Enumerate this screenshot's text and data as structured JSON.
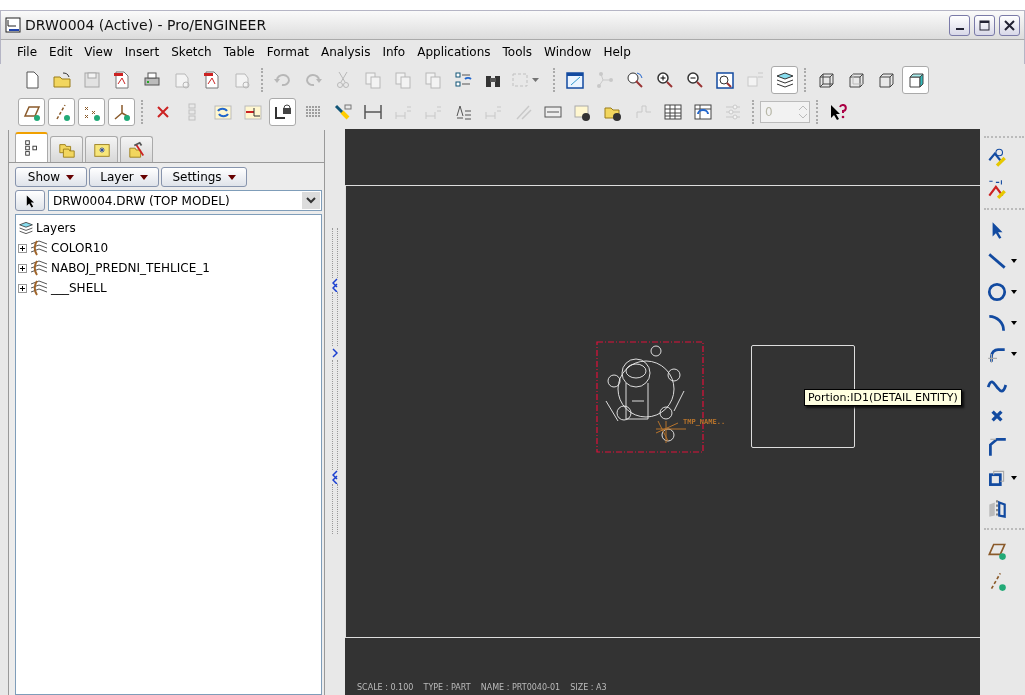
{
  "window": {
    "title": "DRW0004 (Active) - Pro/ENGINEER"
  },
  "menu": [
    "File",
    "Edit",
    "View",
    "Insert",
    "Sketch",
    "Table",
    "Format",
    "Analysis",
    "Info",
    "Applications",
    "Tools",
    "Window",
    "Help"
  ],
  "toolbar_rows": [
    [
      {
        "kind": "button",
        "disabled": false,
        "pressed": false
      },
      {
        "kind": "button",
        "disabled": false,
        "pressed": false
      },
      {
        "kind": "button",
        "disabled": true,
        "pressed": false
      },
      {
        "kind": "button",
        "disabled": false,
        "pressed": false
      },
      {
        "kind": "button",
        "disabled": false,
        "pressed": false
      },
      {
        "kind": "button",
        "disabled": true,
        "pressed": false
      },
      {
        "kind": "button",
        "disabled": false,
        "pressed": false
      },
      {
        "kind": "button",
        "disabled": true,
        "pressed": false
      },
      {
        "kind": "separator"
      },
      {
        "kind": "button",
        "disabled": true,
        "pressed": false
      },
      {
        "kind": "button",
        "disabled": true,
        "pressed": false
      },
      {
        "kind": "button",
        "disabled": true,
        "pressed": false
      },
      {
        "kind": "button",
        "disabled": true,
        "pressed": false
      },
      {
        "kind": "button",
        "disabled": true,
        "pressed": false
      },
      {
        "kind": "button",
        "disabled": true,
        "pressed": false
      },
      {
        "kind": "button",
        "disabled": false,
        "pressed": false
      },
      {
        "kind": "button",
        "disabled": false,
        "pressed": false
      },
      {
        "kind": "dropdown",
        "disabled": true,
        "pressed": false
      },
      {
        "kind": "separator"
      },
      {
        "kind": "button",
        "disabled": false,
        "pressed": false
      },
      {
        "kind": "button",
        "disabled": true,
        "pressed": false
      },
      {
        "kind": "button",
        "disabled": false,
        "pressed": false
      },
      {
        "kind": "button",
        "disabled": false,
        "pressed": false
      },
      {
        "kind": "button",
        "disabled": false,
        "pressed": false
      },
      {
        "kind": "button",
        "disabled": false,
        "pressed": false
      },
      {
        "kind": "button",
        "disabled": true,
        "pressed": false
      },
      {
        "kind": "button",
        "disabled": false,
        "pressed": true
      },
      {
        "kind": "separator"
      },
      {
        "kind": "button",
        "disabled": false,
        "pressed": false
      },
      {
        "kind": "button",
        "disabled": false,
        "pressed": false
      },
      {
        "kind": "button",
        "disabled": false,
        "pressed": false
      },
      {
        "kind": "button",
        "disabled": false,
        "pressed": true
      }
    ],
    [
      {
        "kind": "button",
        "disabled": false,
        "pressed": true
      },
      {
        "kind": "button",
        "disabled": false,
        "pressed": true
      },
      {
        "kind": "button",
        "disabled": false,
        "pressed": true
      },
      {
        "kind": "button",
        "disabled": false,
        "pressed": true
      },
      {
        "kind": "separator"
      },
      {
        "kind": "button",
        "disabled": false,
        "pressed": false
      },
      {
        "kind": "button",
        "disabled": true,
        "pressed": false
      },
      {
        "kind": "button",
        "disabled": false,
        "pressed": false
      },
      {
        "kind": "button",
        "disabled": false,
        "pressed": false
      },
      {
        "kind": "button",
        "disabled": false,
        "pressed": true
      },
      {
        "kind": "button",
        "disabled": false,
        "pressed": false
      },
      {
        "kind": "button",
        "disabled": false,
        "pressed": false
      },
      {
        "kind": "button",
        "disabled": false,
        "pressed": false
      },
      {
        "kind": "button",
        "disabled": true,
        "pressed": false
      },
      {
        "kind": "button",
        "disabled": true,
        "pressed": false
      },
      {
        "kind": "button",
        "disabled": false,
        "pressed": false
      },
      {
        "kind": "button",
        "disabled": true,
        "pressed": false
      },
      {
        "kind": "button",
        "disabled": true,
        "pressed": false
      },
      {
        "kind": "button",
        "disabled": false,
        "pressed": false
      },
      {
        "kind": "button",
        "disabled": false,
        "pressed": false
      },
      {
        "kind": "button",
        "disabled": false,
        "pressed": false
      },
      {
        "kind": "button",
        "disabled": true,
        "pressed": false
      },
      {
        "kind": "button",
        "disabled": false,
        "pressed": false
      },
      {
        "kind": "button",
        "disabled": false,
        "pressed": false
      },
      {
        "kind": "button",
        "disabled": true,
        "pressed": false
      },
      {
        "kind": "separator"
      },
      {
        "kind": "spinner",
        "value": "0",
        "disabled": true
      },
      {
        "kind": "separator"
      },
      {
        "kind": "button",
        "disabled": false,
        "pressed": false
      }
    ]
  ],
  "panel": {
    "tabs": [
      {
        "selected": true
      },
      {
        "selected": false
      },
      {
        "selected": false
      },
      {
        "selected": false
      }
    ],
    "buttons": [
      "Show",
      "Layer",
      "Settings"
    ],
    "model_selector": {
      "value": "DRW0004.DRW (TOP MODEL)"
    },
    "tree": {
      "label": "Layers",
      "children": [
        {
          "label": "COLOR10",
          "expanded": false
        },
        {
          "label": "NABOJ_PREDNI_TEHLICE_1",
          "expanded": false
        },
        {
          "label": "___SHELL",
          "expanded": false
        }
      ]
    }
  },
  "canvas": {
    "note_label": "TMP_NAME..",
    "tooltip": "Portion:ID1(DETAIL ENTITY)",
    "title_block": "SCALE : 0.100    TYPE : PART    NAME : PRT0040-01    SIZE : A3"
  },
  "side_tools": [
    {
      "kind": "separator"
    },
    {
      "kind": "button",
      "has_menu": false
    },
    {
      "kind": "button",
      "has_menu": false
    },
    {
      "kind": "separator"
    },
    {
      "kind": "button",
      "has_menu": false
    },
    {
      "kind": "button",
      "has_menu": true
    },
    {
      "kind": "button",
      "has_menu": true
    },
    {
      "kind": "button",
      "has_menu": true
    },
    {
      "kind": "button",
      "has_menu": true
    },
    {
      "kind": "button",
      "has_menu": false
    },
    {
      "kind": "button",
      "has_menu": false
    },
    {
      "kind": "button",
      "has_menu": false
    },
    {
      "kind": "button",
      "has_menu": true
    },
    {
      "kind": "button",
      "has_menu": false
    },
    {
      "kind": "separator"
    },
    {
      "kind": "button",
      "has_menu": false
    },
    {
      "kind": "button",
      "has_menu": false
    }
  ]
}
